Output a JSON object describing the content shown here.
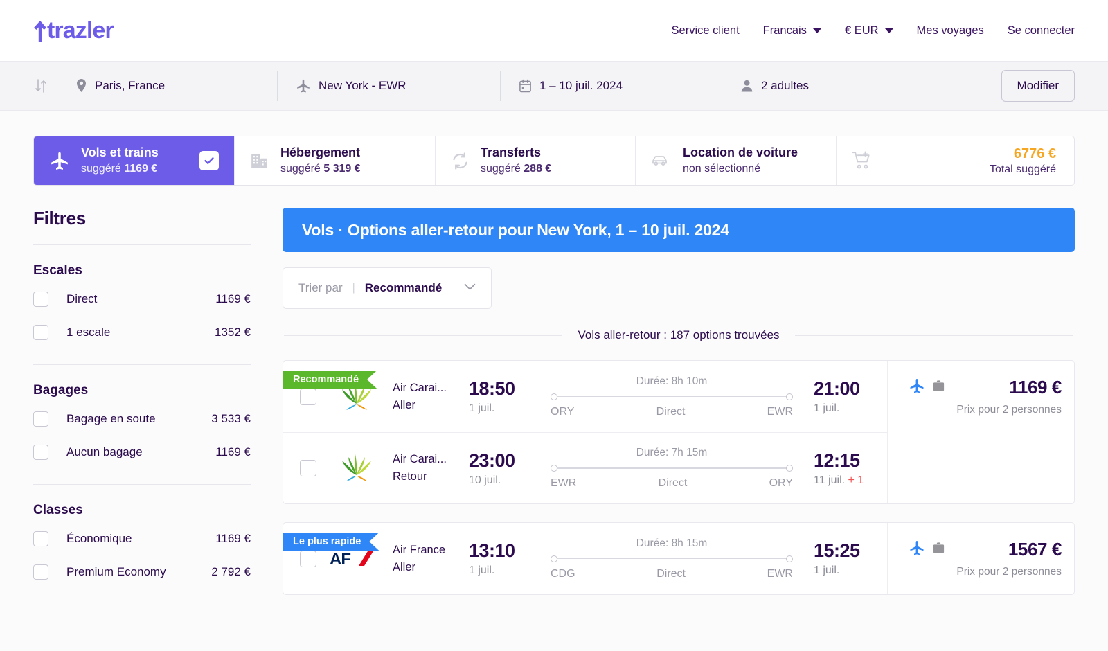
{
  "brand": {
    "name": "trazler",
    "color": "#6c5ce7"
  },
  "nav": {
    "items": [
      {
        "label": "Service client",
        "caret": false
      },
      {
        "label": "Francais",
        "caret": true
      },
      {
        "label": "€ EUR",
        "caret": true
      },
      {
        "label": "Mes voyages",
        "caret": false
      },
      {
        "label": "Se connecter",
        "caret": false
      }
    ]
  },
  "search": {
    "swap_icon": "swap-vertical-icon",
    "origin": {
      "icon": "location-pin-icon",
      "value": "Paris, France"
    },
    "destination": {
      "icon": "airplane-icon",
      "value": "New York - EWR"
    },
    "dates": {
      "icon": "calendar-icon",
      "value": "1 – 10 juil. 2024"
    },
    "passengers": {
      "icon": "person-icon",
      "value": "2 adultes"
    },
    "modify_label": "Modifier"
  },
  "tabs": {
    "flights": {
      "icon": "airplane-icon",
      "title": "Vols et trains",
      "prefix": "suggéré ",
      "price": "1169 €",
      "selected": true
    },
    "hotel": {
      "icon": "building-icon",
      "title": "Hébergement",
      "prefix": "suggéré ",
      "price": "5 319 €"
    },
    "transfer": {
      "icon": "transfer-arrows-icon",
      "title": "Transferts",
      "prefix": "suggéré ",
      "price": "288 €"
    },
    "car": {
      "icon": "car-icon",
      "title": "Location de voiture",
      "sub": "non sélectionné"
    },
    "total": {
      "icon": "cart-add-icon",
      "amount": "6776 €",
      "label": "Total suggéré",
      "color": "#f5a623"
    }
  },
  "sidebar": {
    "title": "Filtres",
    "groups": [
      {
        "title": "Escales",
        "rows": [
          {
            "label": "Direct",
            "price": "1169 €"
          },
          {
            "label": "1 escale",
            "price": "1352 €"
          }
        ]
      },
      {
        "title": "Bagages",
        "rows": [
          {
            "label": "Bagage en soute",
            "price": "3 533 €"
          },
          {
            "label": "Aucun bagage",
            "price": "1169 €"
          }
        ]
      },
      {
        "title": "Classes",
        "rows": [
          {
            "label": "Économique",
            "price": "1169 €"
          },
          {
            "label": "Premium Economy",
            "price": "2 792 €"
          }
        ]
      }
    ]
  },
  "results": {
    "banner": "Vols · Options aller-retour pour New York, 1 – 10 juil. 2024",
    "sort": {
      "placeholder": "Trier par",
      "divider": "|",
      "value": "Recommandé",
      "chevron": "chevron-down-icon"
    },
    "count_text": "Vols aller-retour : 187 options trouvées",
    "cards": [
      {
        "badge": {
          "text": "Recommandé",
          "style": "green"
        },
        "price": "1169 €",
        "price_note": "Prix pour 2 personnes",
        "amenities": [
          "airplane-icon",
          "suitcase-icon"
        ],
        "legs": [
          {
            "airline": "Air Carai...",
            "logo": "air-caraibes-logo",
            "direction": "Aller",
            "dep_time": "18:50",
            "dep_date": "1 juil.",
            "dep_code": "ORY",
            "duration": "Durée: 8h 10m",
            "stops": "Direct",
            "arr_time": "21:00",
            "arr_date": "1 juil.",
            "arr_code": "EWR",
            "arr_plus": ""
          },
          {
            "airline": "Air Carai...",
            "logo": "air-caraibes-logo",
            "direction": "Retour",
            "dep_time": "23:00",
            "dep_date": "10 juil.",
            "dep_code": "EWR",
            "duration": "Durée: 7h 15m",
            "stops": "Direct",
            "arr_time": "12:15",
            "arr_date": "11 juil.",
            "arr_code": "ORY",
            "arr_plus": "+ 1"
          }
        ]
      },
      {
        "badge": {
          "text": "Le plus rapide",
          "style": "blue"
        },
        "price": "1567 €",
        "price_note": "Prix pour 2 personnes",
        "amenities": [
          "airplane-icon",
          "suitcase-icon"
        ],
        "legs": [
          {
            "airline": "Air France",
            "logo": "air-france-logo",
            "direction": "Aller",
            "dep_time": "13:10",
            "dep_date": "1 juil.",
            "dep_code": "CDG",
            "duration": "Durée: 8h 15m",
            "stops": "Direct",
            "arr_time": "15:25",
            "arr_date": "1 juil.",
            "arr_code": "EWR",
            "arr_plus": ""
          }
        ]
      }
    ]
  }
}
